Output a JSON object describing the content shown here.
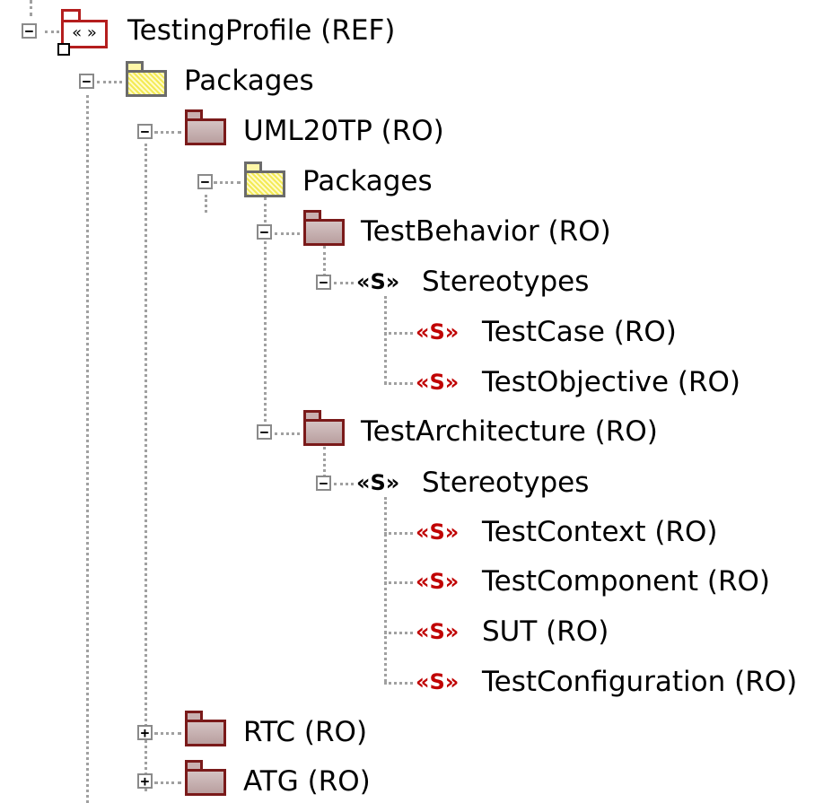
{
  "tree": {
    "root": {
      "label": "TestingProfile (REF)",
      "icon_text": "« »",
      "toggle": "−"
    },
    "packages1": {
      "label": "Packages",
      "toggle": "−"
    },
    "uml20tp": {
      "label": "UML20TP (RO)",
      "toggle": "−"
    },
    "packages2": {
      "label": "Packages",
      "toggle": "−"
    },
    "testbehavior": {
      "label": "TestBehavior (RO)",
      "toggle": "−"
    },
    "stereotypes1": {
      "marker": "«S»",
      "label": "Stereotypes",
      "toggle": "−"
    },
    "testcase": {
      "marker": "«S»",
      "label": "TestCase (RO)"
    },
    "testobjective": {
      "marker": "«S»",
      "label": "TestObjective (RO)"
    },
    "testarchitecture": {
      "label": "TestArchitecture (RO)",
      "toggle": "−"
    },
    "stereotypes2": {
      "marker": "«S»",
      "label": "Stereotypes",
      "toggle": "−"
    },
    "testcontext": {
      "marker": "«S»",
      "label": "TestContext (RO)"
    },
    "testcomponent": {
      "marker": "«S»",
      "label": "TestComponent (RO)"
    },
    "sut": {
      "marker": "«S»",
      "label": "SUT (RO)"
    },
    "testconfiguration": {
      "marker": "«S»",
      "label": "TestConfiguration (RO)"
    },
    "rtc": {
      "label": "RTC (RO)",
      "toggle": "+"
    },
    "atg": {
      "label": "ATG (RO)",
      "toggle": "+"
    }
  },
  "colors": {
    "package_border": "#7a1a1a",
    "profile_border": "#b41e1e",
    "stereotype_marker_red": "#c00000",
    "connector_dots": "#a0a0a0"
  }
}
